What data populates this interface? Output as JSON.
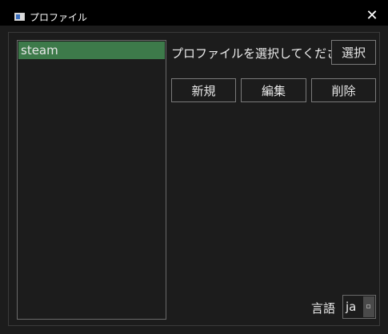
{
  "window": {
    "title": "プロファイル",
    "close_glyph": "✕"
  },
  "profiles": {
    "items": [
      {
        "label": "steam",
        "selected": true
      }
    ]
  },
  "main": {
    "prompt": "プロファイルを選択してください",
    "select_label": "選択",
    "new_label": "新規",
    "edit_label": "編集",
    "delete_label": "削除"
  },
  "language": {
    "label": "言語",
    "value": "ja"
  },
  "colors": {
    "background": "#1c1c1c",
    "titlebar": "#000000",
    "selection": "#3d7a4a"
  },
  "icons": {
    "app": "app-window-icon",
    "close": "close-icon",
    "dropdown": "dropdown-arrow-icon"
  }
}
